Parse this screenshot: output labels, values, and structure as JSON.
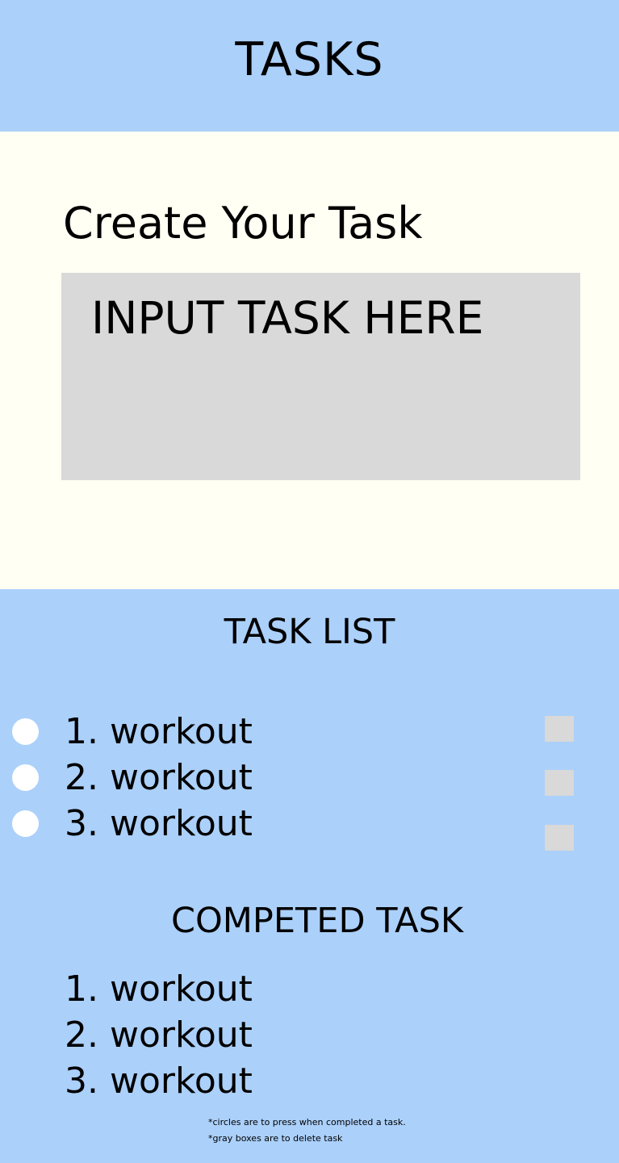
{
  "header": {
    "title": "TASKS"
  },
  "create": {
    "title": "Create Your Task",
    "input_placeholder": "INPUT TASK HERE"
  },
  "task_list": {
    "title": "TASK LIST",
    "items": [
      {
        "label": "1. workout"
      },
      {
        "label": "2. workout"
      },
      {
        "label": "3. workout"
      }
    ]
  },
  "completed": {
    "title": "COMPETED TASK",
    "items": [
      {
        "label": "1. workout"
      },
      {
        "label": "2. workout"
      },
      {
        "label": "3. workout"
      }
    ]
  },
  "notes": {
    "circles": "*circles are to press when completed a task.",
    "gray_boxes": "*gray boxes are to delete task"
  },
  "colors": {
    "header_bg": "#abd0fa",
    "content_bg": "#fffff3",
    "input_bg": "#d9d9d9",
    "circle": "#ffffff",
    "delete_box": "#d9d9d9"
  }
}
